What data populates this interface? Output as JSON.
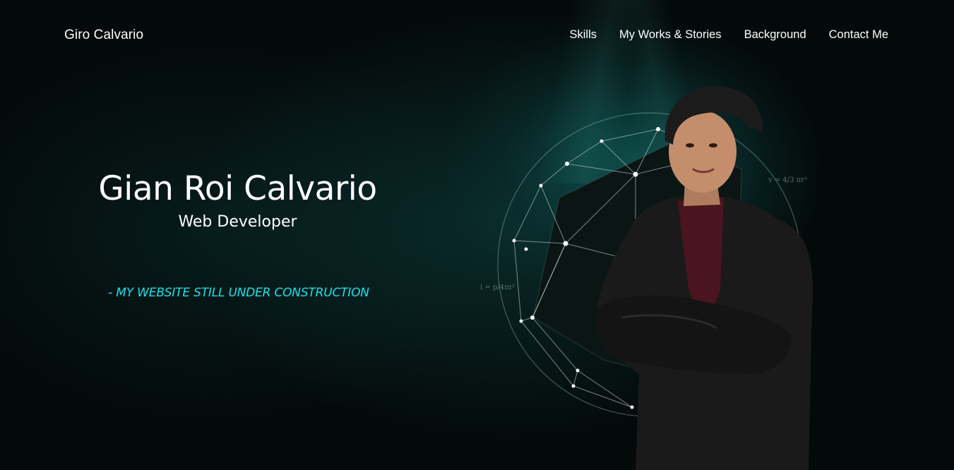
{
  "nav": {
    "brand": "Giro Calvario",
    "items": [
      {
        "label": "Skills"
      },
      {
        "label": "My Works & Stories"
      },
      {
        "label": "Background"
      },
      {
        "label": "Contact Me"
      }
    ]
  },
  "hero": {
    "name": "Gian Roi Calvario",
    "role": "Web Developer",
    "note": "- MY WEBSITE STILL UNDER CONSTRUCTION"
  },
  "colors": {
    "background": "#040909",
    "accent": "#19e3ea",
    "text": "#ffffff"
  },
  "illustration": {
    "icon": "geometric-sphere-with-portrait"
  }
}
